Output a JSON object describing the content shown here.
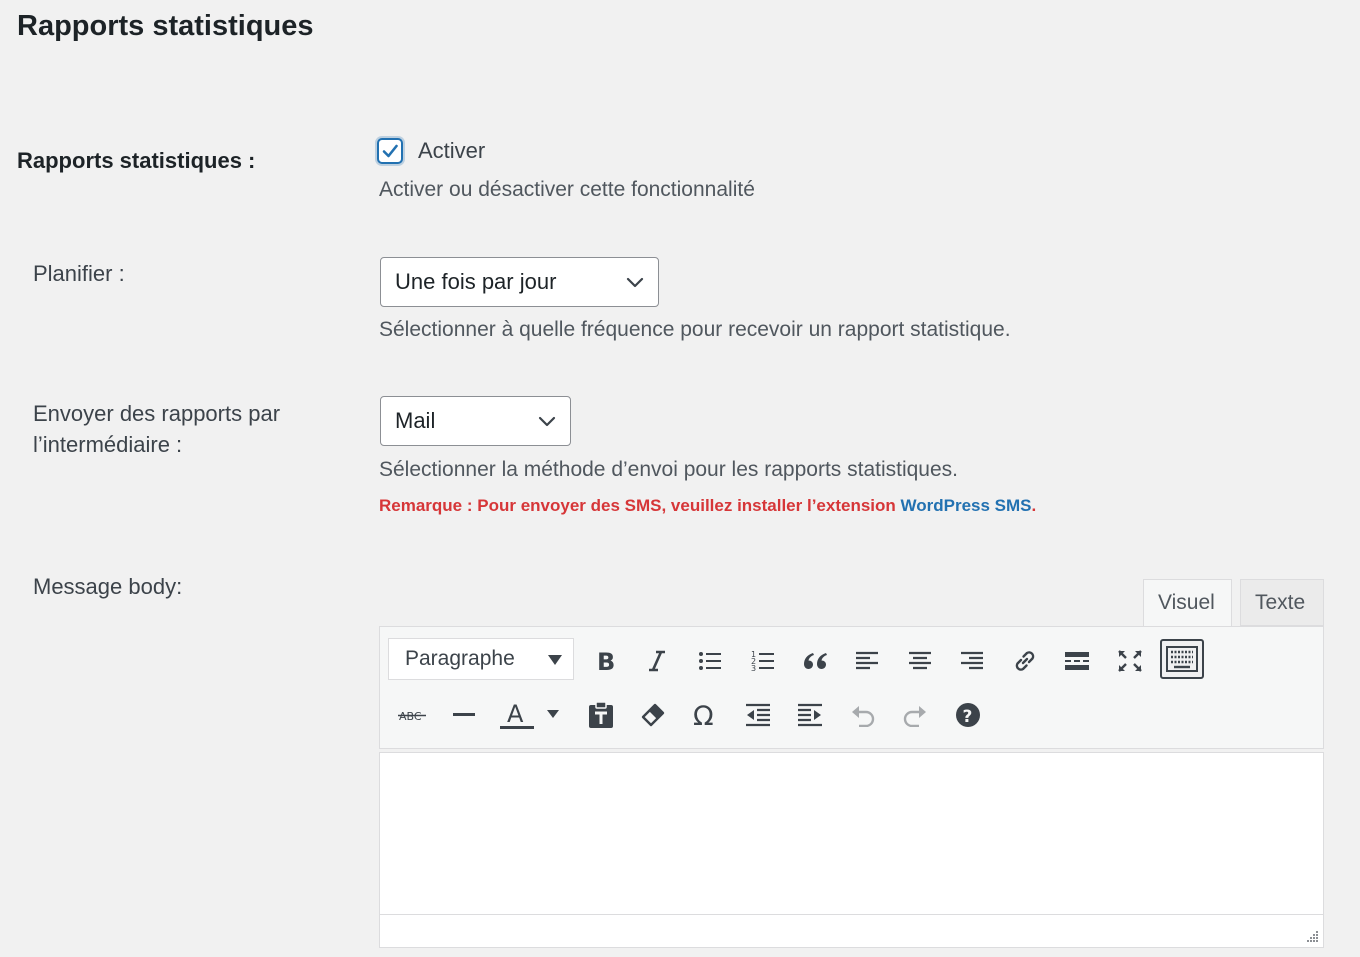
{
  "page_title": "Rapports statistiques",
  "enable_row": {
    "label": "Rapports statistiques :",
    "checkbox_label": "Activer",
    "checked": true,
    "description": "Activer ou désactiver cette fonctionnalité"
  },
  "schedule_row": {
    "label": "Planifier :",
    "selected": "Une fois par jour",
    "description": "Sélectionner à quelle fréquence pour recevoir un rapport statistique."
  },
  "send_via_row": {
    "label_line1": "Envoyer des rapports par",
    "label_line2": "l’intermédiaire :",
    "selected": "Mail",
    "description": "Sélectionner la méthode d’envoi pour les rapports statistiques.",
    "note_prefix": "Remarque : Pour envoyer des SMS, veuillez installer l’extension ",
    "note_link": "WordPress SMS",
    "note_suffix": "."
  },
  "message_row": {
    "label": "Message body:",
    "tabs": {
      "visual": "Visuel",
      "text": "Texte"
    },
    "format_select": "Paragraphe",
    "toolbar_row1": [
      "bold-icon",
      "italic-icon",
      "bulleted-list-icon",
      "numbered-list-icon",
      "blockquote-icon",
      "align-left-icon",
      "align-center-icon",
      "align-right-icon",
      "link-icon",
      "read-more-icon",
      "fullscreen-icon",
      "toolbar-toggle-icon"
    ],
    "toolbar_row2": [
      "strikethrough-icon",
      "horizontal-line-icon",
      "text-color-icon",
      "paste-text-icon",
      "clear-formatting-icon",
      "special-character-icon",
      "outdent-icon",
      "indent-icon",
      "undo-icon",
      "redo-icon",
      "help-icon"
    ],
    "strikethrough_glyph": "ABC",
    "text_color_glyph": "A",
    "special_char_glyph": "Ω",
    "help_glyph": "?",
    "body": ""
  },
  "colors": {
    "accent": "#2271b1",
    "note_red": "#d63638",
    "background": "#f1f1f1"
  }
}
